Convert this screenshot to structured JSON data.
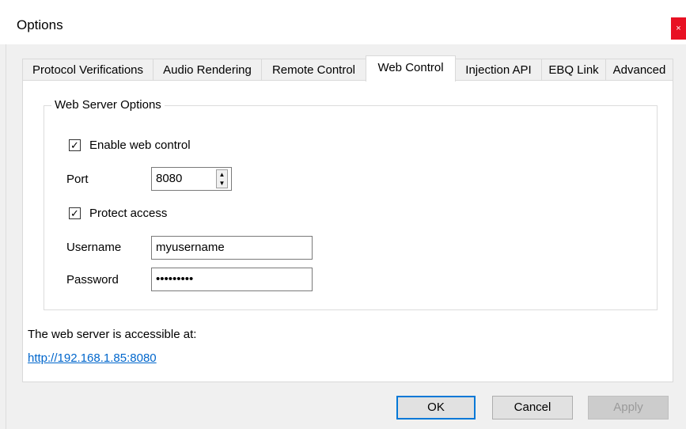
{
  "window": {
    "title": "Options",
    "close_glyph": "×"
  },
  "tabs": [
    {
      "label": "Protocol Verifications"
    },
    {
      "label": "Audio Rendering"
    },
    {
      "label": "Remote Control"
    },
    {
      "label": "Web Control",
      "active": true
    },
    {
      "label": "Injection API"
    },
    {
      "label": "EBQ Link"
    },
    {
      "label": "Advanced"
    }
  ],
  "web_server": {
    "group_title": "Web Server Options",
    "enable_label": "Enable web control",
    "enable_checked": true,
    "port_label": "Port",
    "port_value": "8080",
    "protect_label": "Protect access",
    "protect_checked": true,
    "username_label": "Username",
    "username_value": "myusername",
    "password_label": "Password",
    "password_value": "•••••••••"
  },
  "access": {
    "text": "The web server is accessible at:",
    "url": "http://192.168.1.85:8080"
  },
  "buttons": {
    "ok": "OK",
    "cancel": "Cancel",
    "apply": "Apply"
  },
  "glyphs": {
    "check": "✓",
    "spin_up": "▲",
    "spin_down": "▼"
  }
}
